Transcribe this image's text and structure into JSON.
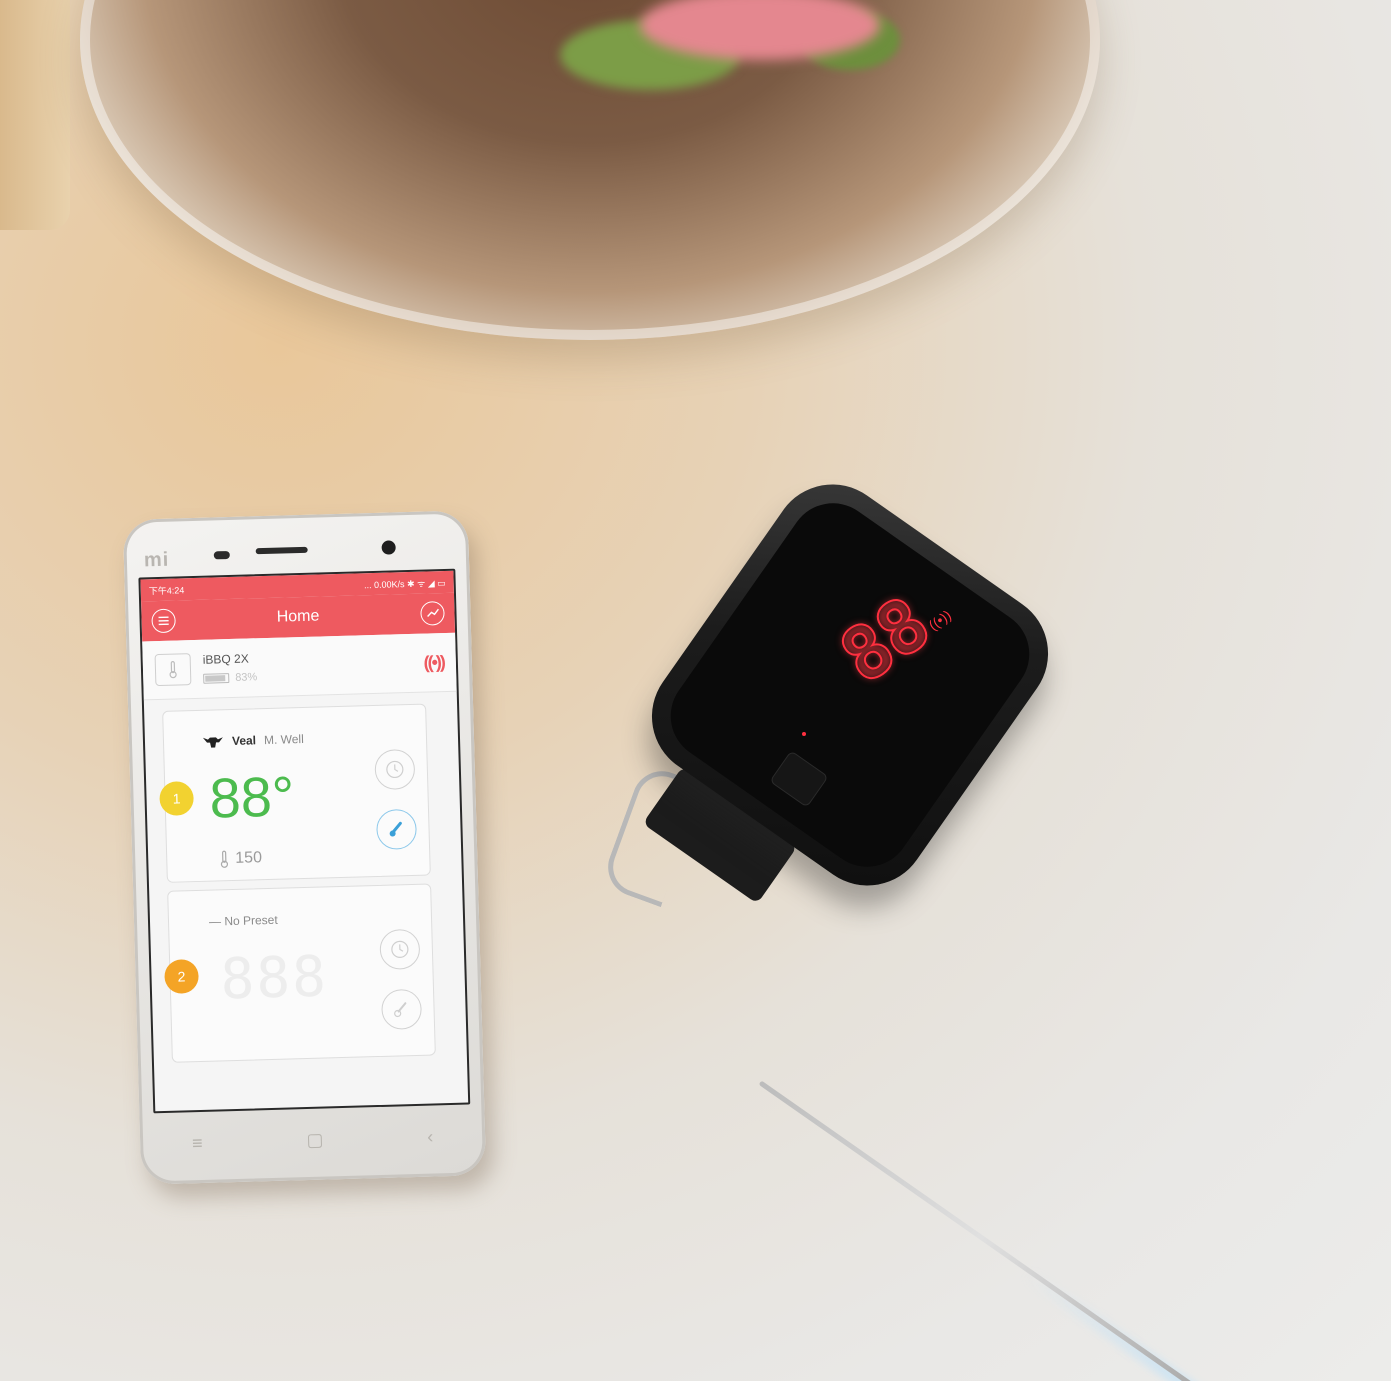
{
  "phone": {
    "brand": "mi",
    "statusbar": {
      "time": "下午4:24",
      "indicators": "... 0.00K/s ✱ ᯤ ◢ ▭"
    },
    "appbar": {
      "title": "Home",
      "menu_icon": "menu-icon",
      "chart_icon": "chart-icon"
    },
    "device": {
      "name": "iBBQ 2X",
      "battery_percent": "83%",
      "battery_level": 0.83,
      "signal_icon": "signal-icon",
      "signal_color": "#ee5a60"
    },
    "probes": [
      {
        "number": "1",
        "meat": "Veal",
        "doneness": "M. Well",
        "temperature": "88°",
        "target": "150",
        "badge_color": "#f2d230",
        "temp_color": "#4cbb4e"
      },
      {
        "number": "2",
        "preset": "— No Preset",
        "temperature": "888",
        "badge_color": "#f4a426"
      }
    ],
    "nav": [
      "≡",
      "▢",
      "‹"
    ]
  },
  "thermometer": {
    "display": "88",
    "display_color": "#ff2f3f"
  }
}
